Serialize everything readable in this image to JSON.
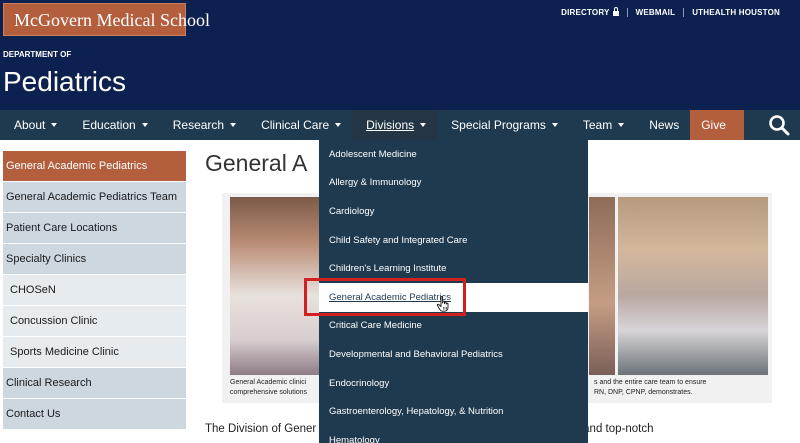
{
  "header": {
    "logo_text": "McGovern Medical School",
    "utility_links": [
      "DIRECTORY",
      "WEBMAIL",
      "UTHEALTH HOUSTON"
    ],
    "dept_label": "DEPARTMENT OF",
    "dept_title": "Pediatrics"
  },
  "nav": {
    "items": [
      {
        "label": "About",
        "has_caret": true
      },
      {
        "label": "Education",
        "has_caret": true
      },
      {
        "label": "Research",
        "has_caret": true
      },
      {
        "label": "Clinical Care",
        "has_caret": true
      },
      {
        "label": "Divisions",
        "has_caret": true
      },
      {
        "label": "Special Programs",
        "has_caret": true
      },
      {
        "label": "Team",
        "has_caret": true
      },
      {
        "label": "News",
        "has_caret": false
      },
      {
        "label": "Give",
        "has_caret": false
      }
    ],
    "active": "Divisions"
  },
  "sidebar": {
    "items": [
      {
        "label": "General Academic Pediatrics",
        "active": true,
        "sub": false
      },
      {
        "label": "General Academic Pediatrics Team",
        "active": false,
        "sub": false
      },
      {
        "label": "Patient Care Locations",
        "active": false,
        "sub": false
      },
      {
        "label": "Specialty Clinics",
        "active": false,
        "sub": false
      },
      {
        "label": "CHOSeN",
        "active": false,
        "sub": true
      },
      {
        "label": "Concussion Clinic",
        "active": false,
        "sub": true
      },
      {
        "label": "Sports Medicine Clinic",
        "active": false,
        "sub": true
      },
      {
        "label": "Clinical Research",
        "active": false,
        "sub": false
      },
      {
        "label": "Contact Us",
        "active": false,
        "sub": false
      }
    ]
  },
  "main": {
    "page_title": "General A",
    "caption_left_1": "General Academic clinici",
    "caption_left_2": "comprehensive solutions",
    "caption_right_1": "s and the entire care team to ensure",
    "caption_right_2": "RN, DNP, CPNP, demonstrates.",
    "body_left": "The Division of Gener",
    "body_right": "nt-centered care and top-notch"
  },
  "dropdown": {
    "items": [
      "Adolescent Medicine",
      "Allergy & Immunology",
      "Cardiology",
      "Child Safety and Integrated Care",
      "Children's Learning Institute",
      "General Academic Pediatrics",
      "Critical Care Medicine",
      "Developmental and Behavioral Pediatrics",
      "Endocrinology",
      "Gastroenterology, Hepatology, & Nutrition",
      "Hematology"
    ],
    "hovered": "General Academic Pediatrics"
  },
  "colors": {
    "header_navy": "#0d2150",
    "nav_bg": "#1f3a4f",
    "accent_rust": "#b35f3e",
    "sidebar_blue": "#cdd7e0",
    "highlight_red": "#d12020"
  }
}
